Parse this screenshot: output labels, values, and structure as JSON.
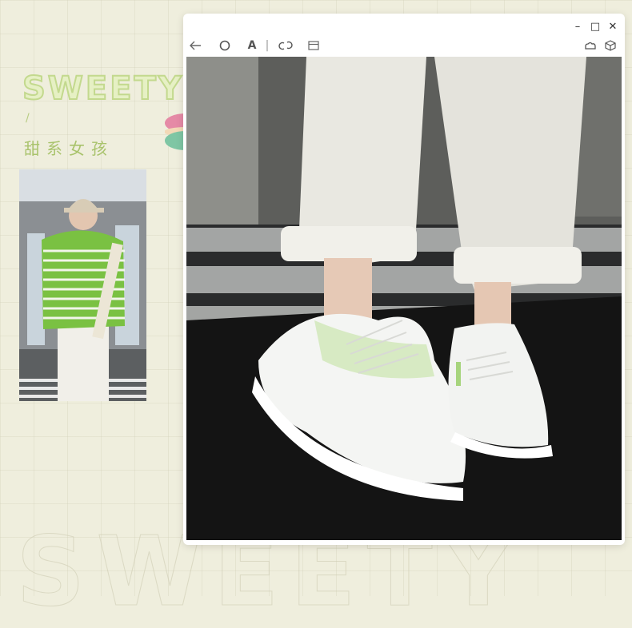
{
  "background": {
    "brand_title": "SWEETY",
    "slash": "/",
    "subtitle": "甜系女孩"
  },
  "window": {
    "controls": {
      "minimize": "–",
      "maximize": "□",
      "close": "✕"
    },
    "toolbar": {
      "back_icon": "arrow-left-icon",
      "rotate_icon": "circle-icon",
      "text_tool": "A",
      "separator": "|",
      "link_icon": "link-icon",
      "frame_icon": "window-icon",
      "share_icon": "cloud-icon",
      "box_icon": "cube-icon"
    }
  },
  "colors": {
    "background": "#efeedd",
    "accent_green": "#a9c36c",
    "window_bg": "#ffffff"
  }
}
